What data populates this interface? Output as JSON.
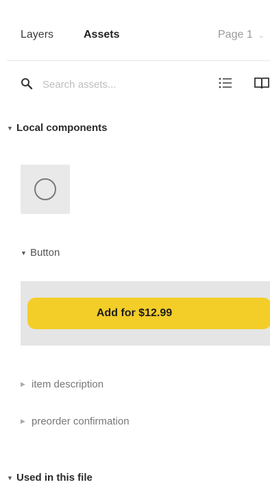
{
  "header": {
    "tabs": [
      {
        "label": "Layers"
      },
      {
        "label": "Assets"
      }
    ],
    "page_select": "Page 1"
  },
  "search": {
    "placeholder": "Search assets...",
    "value": ""
  },
  "local_components": {
    "title": "Local components",
    "groups": [
      {
        "label": "Button"
      },
      {
        "label": "item description"
      },
      {
        "label": "preorder confirmation"
      }
    ],
    "button_preview_label": "Add for $12.99"
  },
  "used_in_file": {
    "title": "Used in this file"
  },
  "colors": {
    "accent_button": "#f3cd28"
  },
  "icons": [
    "search-icon",
    "list-view-icon",
    "library-book-icon",
    "caret-down-icon",
    "caret-right-icon",
    "circle-icon"
  ]
}
